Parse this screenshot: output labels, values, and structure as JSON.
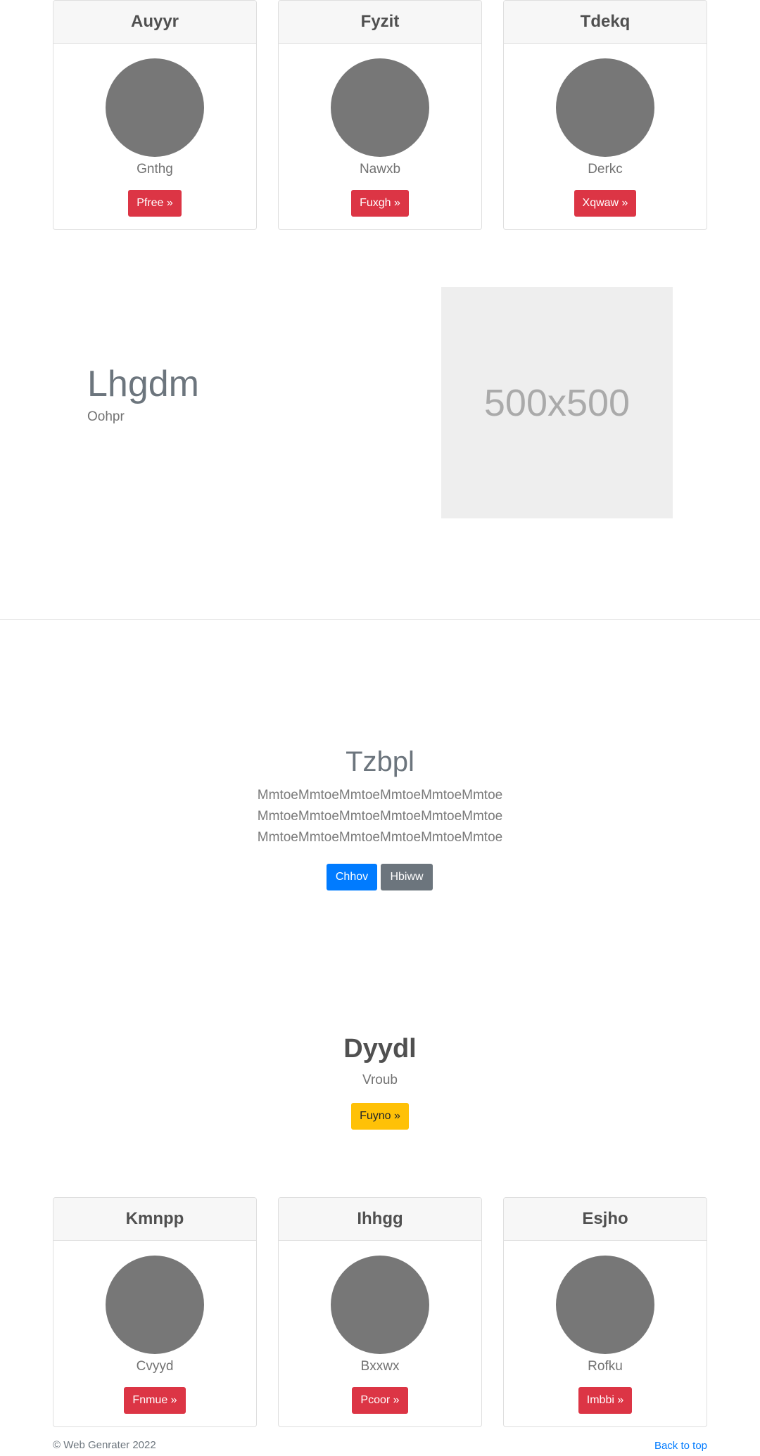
{
  "cards_top": [
    {
      "title": "Auyyr",
      "text": "Gnthg",
      "button": "Pfree »"
    },
    {
      "title": "Fyzit",
      "text": "Nawxb",
      "button": "Fuxgh »"
    },
    {
      "title": "Tdekq",
      "text": "Derkc",
      "button": "Xqwaw »"
    }
  ],
  "feature": {
    "heading": "Lhgdm",
    "subheading": "Oohpr",
    "image_label": "500x500"
  },
  "jumbotron": {
    "title": "Tzbpl",
    "lead_lines": [
      "MmtoeMmtoeMmtoeMmtoeMmtoeMmtoe",
      "MmtoeMmtoeMmtoeMmtoeMmtoeMmtoe",
      "MmtoeMmtoeMmtoeMmtoeMmtoeMmtoe"
    ],
    "primary_button": "Chhov",
    "secondary_button": "Hbiww"
  },
  "center": {
    "title": "Dyydl",
    "subtitle": "Vroub",
    "button": "Fuyno »"
  },
  "cards_bottom": [
    {
      "title": "Kmnpp",
      "text": "Cvyyd",
      "button": "Fnmue »"
    },
    {
      "title": "Ihhgg",
      "text": "Bxxwx",
      "button": "Pcoor »"
    },
    {
      "title": "Esjho",
      "text": "Rofku",
      "button": "Imbbi »"
    }
  ],
  "footer": {
    "copyright": "© Web Genrater 2022",
    "back_to_top": "Back to top"
  },
  "colors": {
    "danger": "#dc3545",
    "primary": "#007bff",
    "secondary": "#6c757d",
    "warning": "#ffc107",
    "avatar": "#777777"
  }
}
